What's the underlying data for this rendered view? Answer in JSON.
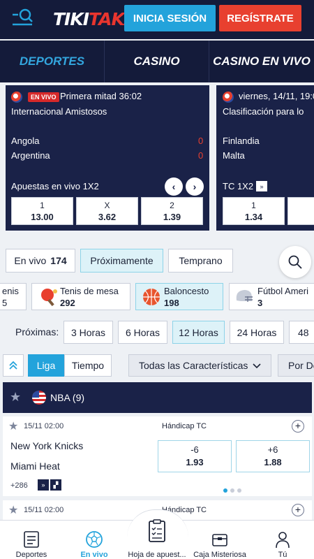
{
  "header": {
    "logo_part1": "TIKI",
    "logo_part2": "TAKA",
    "login_label": "INICIA SESIÓN",
    "register_label": "REGÍSTRATE"
  },
  "main_tabs": [
    "DEPORTES",
    "CASINO",
    "CASINO EN VIVO"
  ],
  "live_cards": [
    {
      "badge": "EN VIVO",
      "timeline": "Primera mitad 36:02",
      "league": "Internacional Amistosos",
      "team1": "Angola",
      "score1": "0",
      "team2": "Argentina",
      "score2": "0",
      "market": "Apuestas en vivo 1X2",
      "odds": [
        {
          "label": "1",
          "value": "13.00"
        },
        {
          "label": "X",
          "value": "3.62"
        },
        {
          "label": "2",
          "value": "1.39"
        }
      ]
    },
    {
      "timeline": "viernes, 14/11, 19:0",
      "league": "Clasificación para lo",
      "team1": "Finlandia",
      "team2": "Malta",
      "market": "TC 1X2",
      "odds": [
        {
          "label": "1",
          "value": "1.34"
        }
      ]
    }
  ],
  "filters": {
    "en_vivo_label": "En vivo",
    "en_vivo_count": "174",
    "proximamente": "Próximamente",
    "temprano": "Temprano"
  },
  "sports": [
    {
      "name": "enis",
      "count": "5"
    },
    {
      "name": "Tenis de mesa",
      "count": "292"
    },
    {
      "name": "Baloncesto",
      "count": "198"
    },
    {
      "name": "Fútbol Ameri",
      "count": "3"
    }
  ],
  "times": {
    "label": "Próximas:",
    "options": [
      "3 Horas",
      "6 Horas",
      "12 Horas",
      "24 Horas",
      "48"
    ]
  },
  "controls": {
    "liga": "Liga",
    "tiempo": "Tiempo",
    "features": "Todas las Características",
    "sort": "Por De"
  },
  "league": {
    "name": "NBA (9)"
  },
  "events": [
    {
      "date": "15/11 02:00",
      "market": "Hándicap TC",
      "team1": "New York Knicks",
      "team2": "Miami Heat",
      "odds": [
        {
          "label": "-6",
          "value": "1.93"
        },
        {
          "label": "+6",
          "value": "1.88"
        }
      ],
      "more": "+286"
    },
    {
      "date": "15/11 02:00",
      "market": "Hándicap TC"
    }
  ],
  "bottom_nav": [
    "Deportes",
    "En vivo",
    "Hoja de apuest...",
    "Caja Misteriosa",
    "Tú"
  ],
  "colors": {
    "navy": "#141b3a",
    "accent_blue": "#23a3db",
    "accent_red": "#e8402f"
  }
}
